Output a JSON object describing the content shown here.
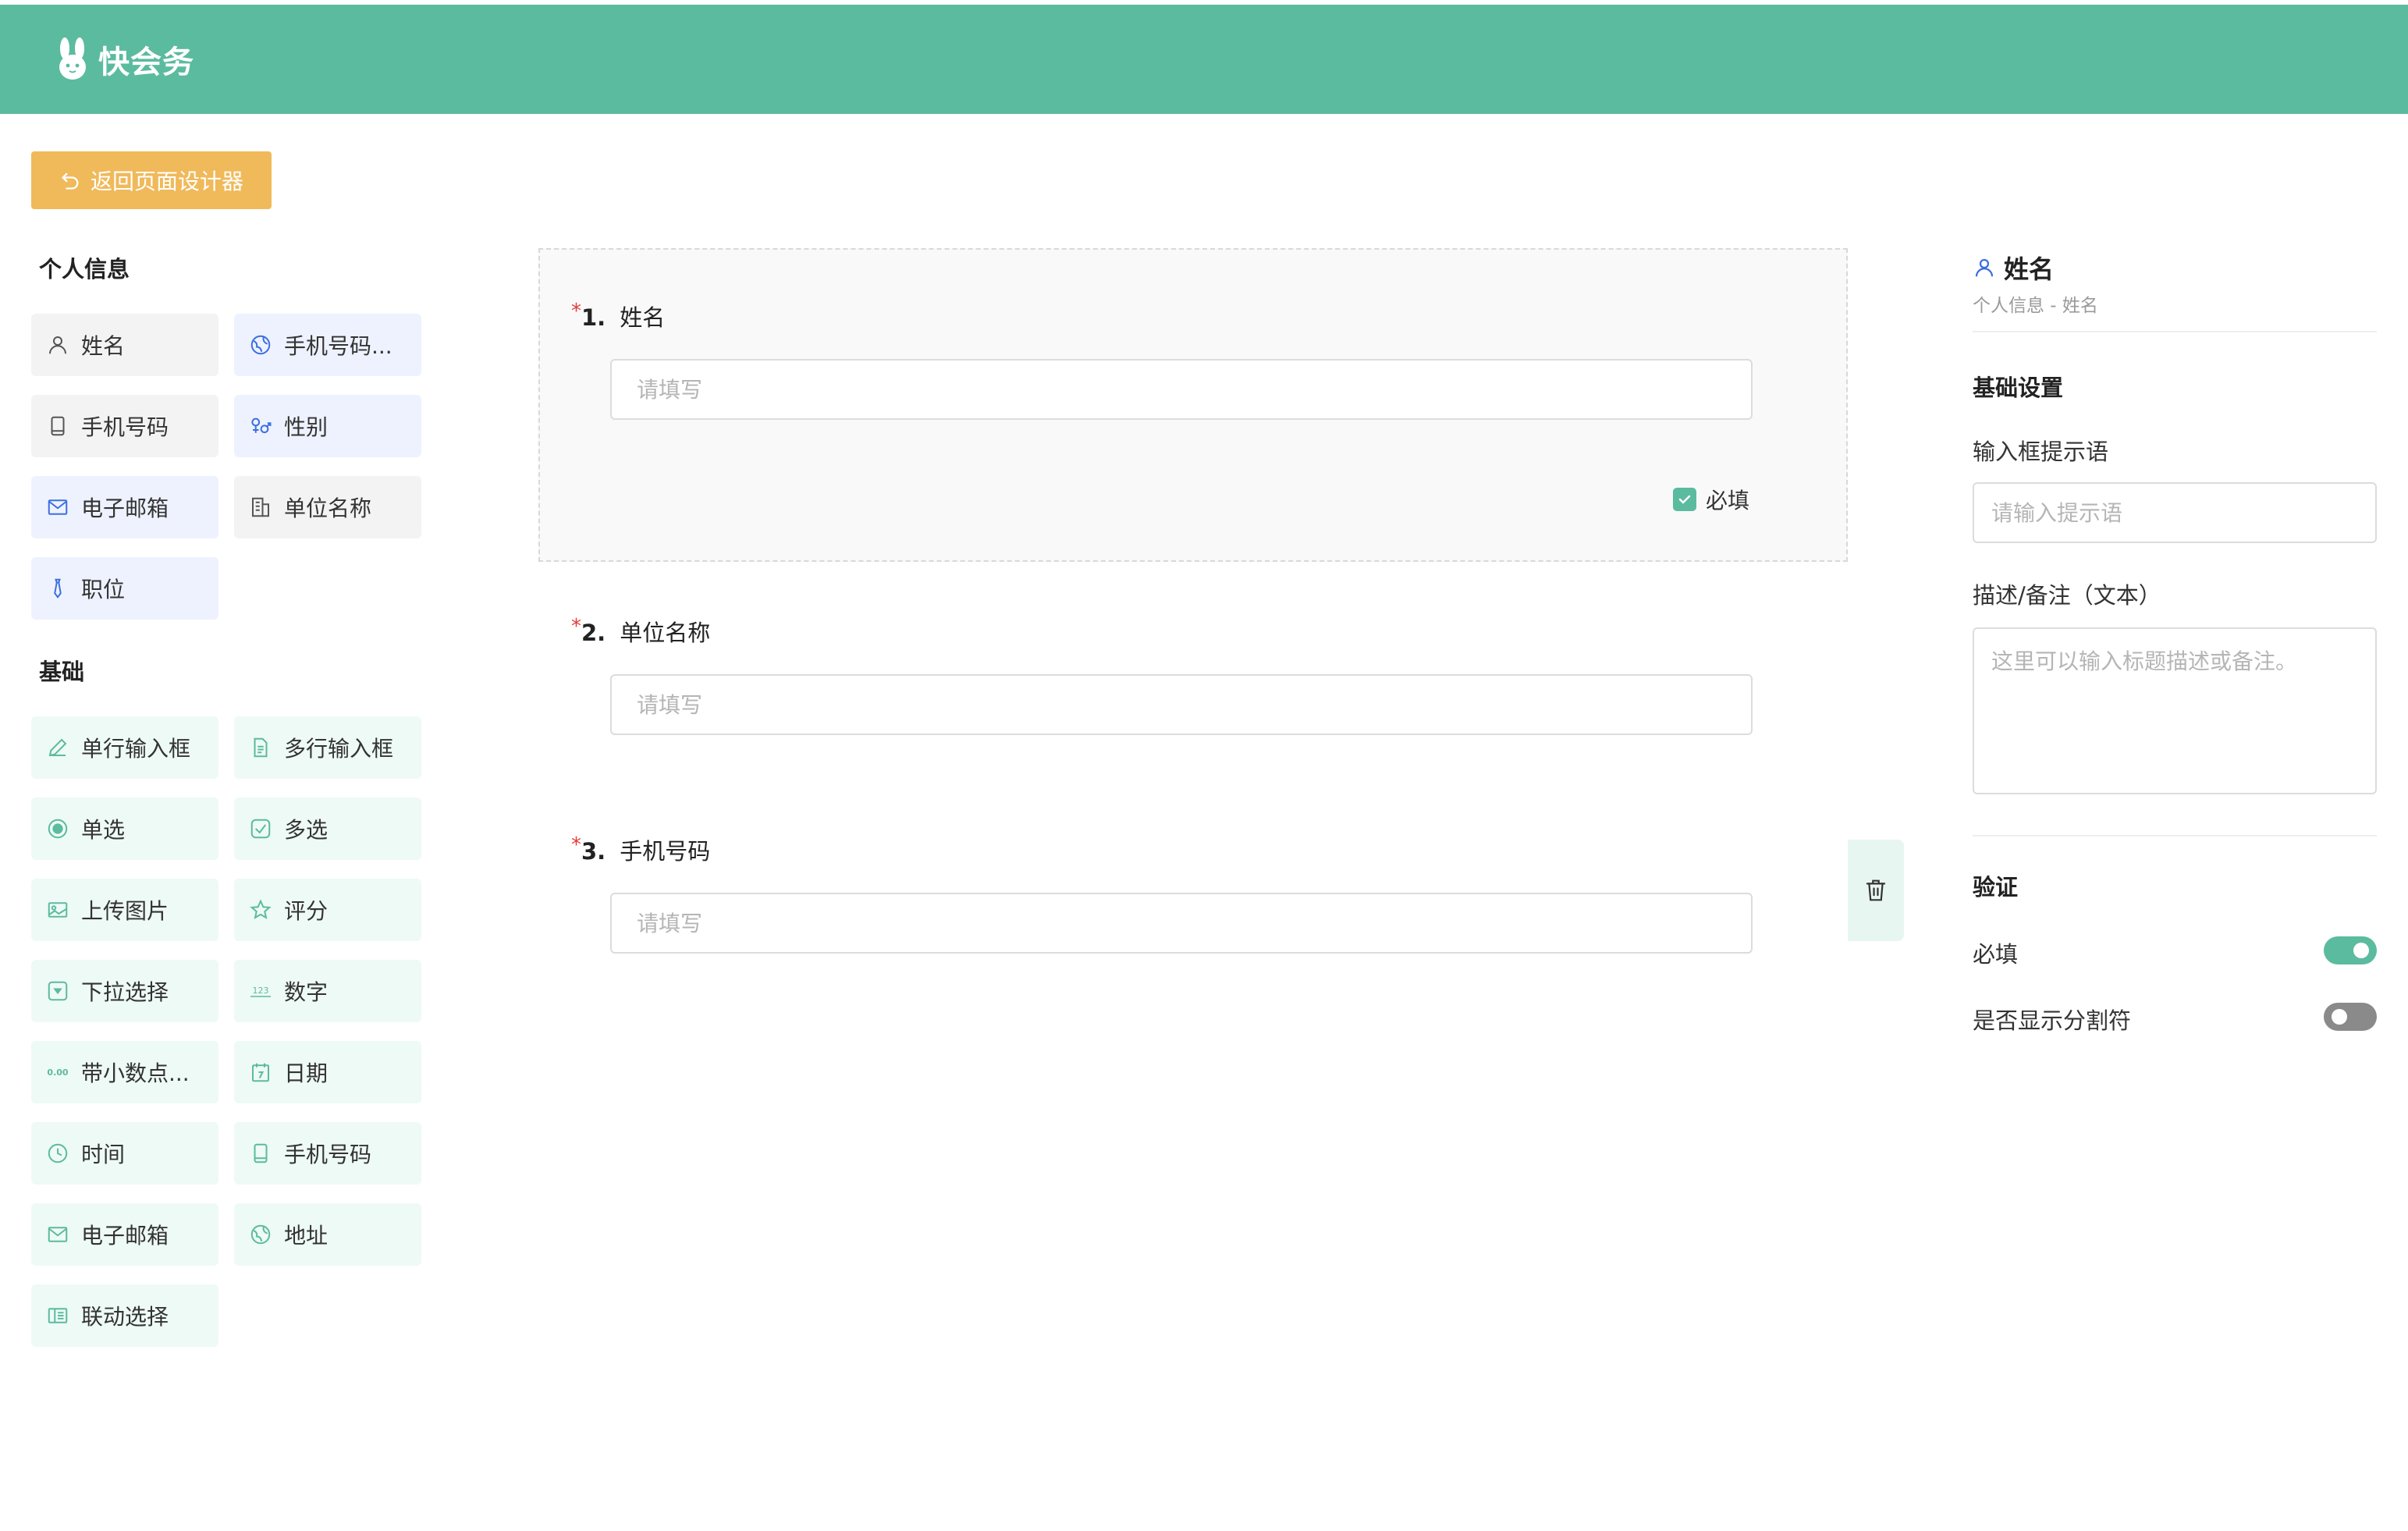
{
  "header": {
    "brand": "快会务"
  },
  "toolbar": {
    "back_label": "返回页面设计器"
  },
  "sidebar": {
    "personal_title": "个人信息",
    "personal_items": [
      {
        "label": "姓名",
        "icon": "user-icon"
      },
      {
        "label": "手机号码...",
        "icon": "globe-icon"
      },
      {
        "label": "手机号码",
        "icon": "phone-icon"
      },
      {
        "label": "性别",
        "icon": "gender-icon"
      },
      {
        "label": "电子邮箱",
        "icon": "mail-icon"
      },
      {
        "label": "单位名称",
        "icon": "building-icon"
      },
      {
        "label": "职位",
        "icon": "tie-icon"
      }
    ],
    "basic_title": "基础",
    "basic_items": [
      {
        "label": "单行输入框",
        "icon": "pencil-icon"
      },
      {
        "label": "多行输入框",
        "icon": "document-icon"
      },
      {
        "label": "单选",
        "icon": "radio-icon"
      },
      {
        "label": "多选",
        "icon": "checkbox-icon"
      },
      {
        "label": "上传图片",
        "icon": "image-icon"
      },
      {
        "label": "评分",
        "icon": "star-icon"
      },
      {
        "label": "下拉选择",
        "icon": "dropdown-icon"
      },
      {
        "label": "数字",
        "icon": "number-icon"
      },
      {
        "label": "带小数点...",
        "icon": "decimal-icon"
      },
      {
        "label": "日期",
        "icon": "calendar-icon"
      },
      {
        "label": "时间",
        "icon": "clock-icon"
      },
      {
        "label": "手机号码",
        "icon": "phone-icon"
      },
      {
        "label": "电子邮箱",
        "icon": "mail-icon"
      },
      {
        "label": "地址",
        "icon": "globe-icon"
      },
      {
        "label": "联动选择",
        "icon": "cascade-icon"
      }
    ],
    "decimal_glyph": "0.00",
    "number_glyph": "123"
  },
  "form": {
    "questions": [
      {
        "star": "*",
        "num": "1.",
        "label": "姓名",
        "placeholder": "请填写"
      },
      {
        "star": "*",
        "num": "2.",
        "label": "单位名称",
        "placeholder": "请填写"
      },
      {
        "star": "*",
        "num": "3.",
        "label": "手机号码",
        "placeholder": "请填写"
      }
    ],
    "required_label": "必填"
  },
  "panel": {
    "title": "姓名",
    "subtitle": "个人信息 - 姓名",
    "basic_settings": "基础设置",
    "placeholder_label": "输入框提示语",
    "placeholder_input_placeholder": "请输入提示语",
    "desc_label": "描述/备注（文本）",
    "desc_placeholder": "这里可以输入标题描述或备注。",
    "validation_title": "验证",
    "required_label": "必填",
    "required_on": true,
    "separator_label": "是否显示分割符",
    "separator_on": false
  },
  "colors": {
    "primary": "#5bbb9f",
    "back_button": "#f0b95a",
    "required_star": "#e23c3c",
    "personal_icon": "#3b6fe0"
  }
}
